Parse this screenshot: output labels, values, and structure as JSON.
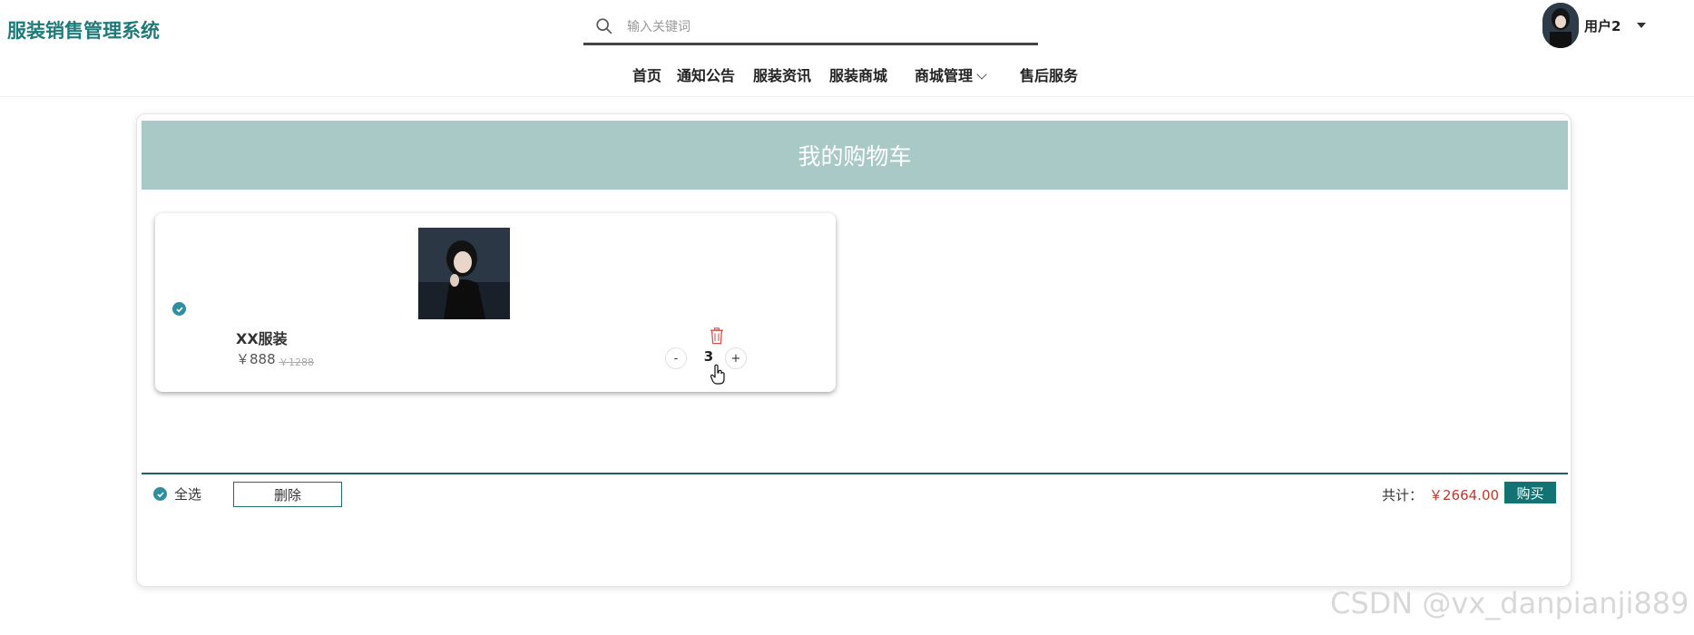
{
  "header": {
    "brand": "服装销售管理系统",
    "search": {
      "placeholder": "输入关键词"
    },
    "user": {
      "name": "用户2"
    }
  },
  "nav": {
    "items": [
      "首页",
      "通知公告",
      "服装资讯",
      "服装商城",
      "商城管理",
      "售后服务"
    ]
  },
  "cart": {
    "title": "我的购物车",
    "item": {
      "name": "XX服装",
      "price": "￥888",
      "original_price": "￥1288",
      "quantity": "3",
      "minus": "-",
      "plus": "+",
      "checked": true
    },
    "footer": {
      "select_all": "全选",
      "delete": "删除",
      "total_label": "共计：",
      "total_value": "￥2664.00",
      "buy": "购买"
    }
  },
  "colors": {
    "brand": "#1f7a7a",
    "title_bar": "#a8c9c5",
    "check": "#2f8fa0",
    "price_red": "#c0392b",
    "buy_button": "#137373"
  },
  "watermark": "CSDN @vx_danpianji889"
}
